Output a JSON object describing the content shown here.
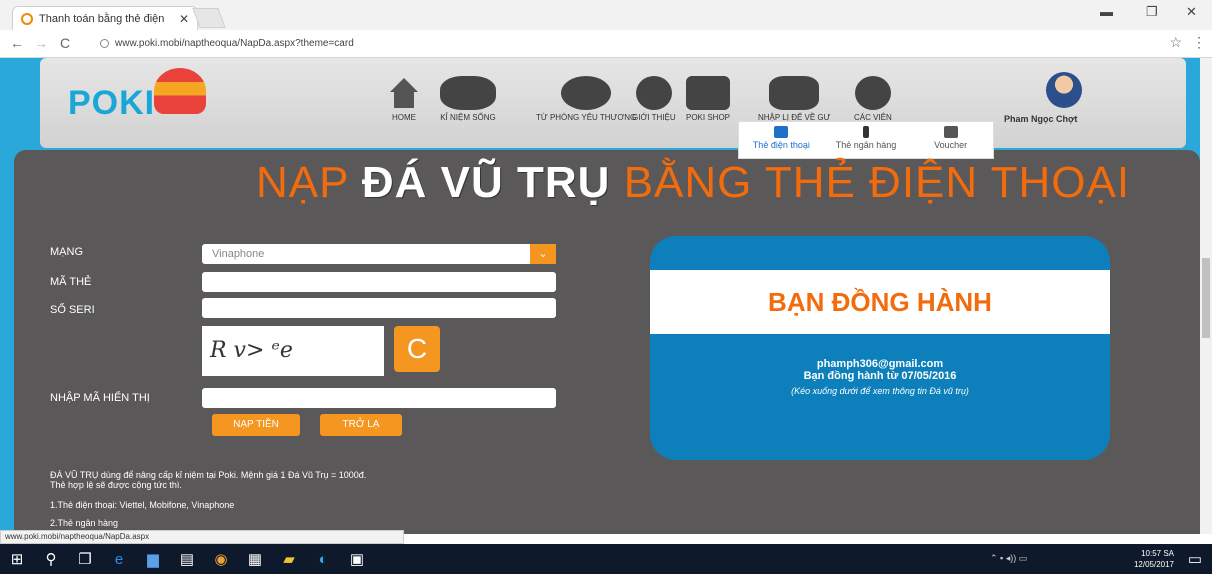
{
  "browser": {
    "tab_title": "Thanh toán bằng thẻ điện",
    "tab_close": "✕",
    "url": "www.poki.mobi/naptheoqua/NapDa.aspx?theme=card",
    "window_minimize": "▬",
    "window_restore": "❐",
    "window_close": "✕",
    "star": "☆",
    "menu": "⋮",
    "back": "←",
    "forward": "→",
    "reload": "C"
  },
  "nav": {
    "logo": "POKI",
    "items": [
      {
        "label": "HOME",
        "icon": "home-icon"
      },
      {
        "label": "KỈ NIỆM SỐNG",
        "icon": "kids-icon"
      },
      {
        "label": "TỪ PHÒNG YÊU THƯƠNG",
        "icon": "owl-icon"
      },
      {
        "label": "GIỚI THIỆU",
        "icon": "bee-icon"
      },
      {
        "label": "POKI SHOP",
        "icon": "shop-icon"
      },
      {
        "label": "NHẬP LỊ ĐỂ VỀ GƯ",
        "icon": "family-icon"
      },
      {
        "label": "CÁC VIÊN",
        "icon": "girl-icon"
      }
    ],
    "user_name": "Pham Ngọc Chợt"
  },
  "dropdown": {
    "items": [
      "Thẻ điện thoại",
      "Thẻ ngân hàng",
      "Voucher"
    ]
  },
  "title": {
    "prefix": "NẠP ",
    "highlight": "ĐÁ VŨ TRỤ",
    "suffix": " BẰNG THẺ ĐIỆN THOẠI"
  },
  "form": {
    "network_label": "MẠNG",
    "network_value": "Vinaphone",
    "card_code_label": "MÃ THẺ",
    "serial_label": "SỐ SERI",
    "captcha_text": "R v> ᵉe",
    "captcha_input_label": "NHẬP MÃ HIỂN THỊ",
    "refresh_symbol": "C",
    "submit_label": "NẠP TIỀN",
    "reset_label": "TRỞ LẠ"
  },
  "notes": {
    "line1": "ĐÁ VŨ TRỤ dùng để nâng cấp kỉ niệm tại Poki. Mệnh giá 1 Đá Vũ Trụ = 1000đ.",
    "line1b": "Thẻ hợp lệ sẽ được cộng tức thì.",
    "item1": "1.Thẻ điện thoại: Viettel, Mobifone, Vinaphone",
    "item2": "2.Thẻ ngân hàng"
  },
  "card": {
    "title": "BẠN ĐỒNG HÀNH",
    "email": "phamph306@gmail.com",
    "since": "Bạn đồng hành từ 07/05/2016",
    "hint": "(Kéo xuống dưới để xem thông tin Đá vũ trụ)"
  },
  "statusbar": {
    "text": "www.poki.mobi/naptheoqua/NapDa.aspx"
  },
  "taskbar": {
    "time": "10:57 SA",
    "date": "12/05/2017",
    "lang": "ENG"
  }
}
